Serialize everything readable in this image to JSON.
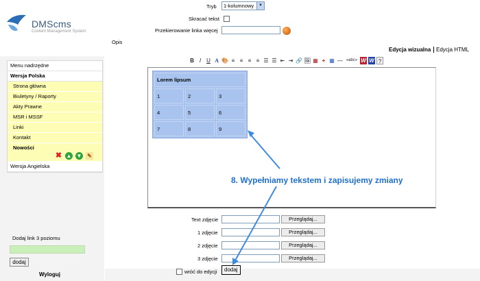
{
  "brand": {
    "name": "DMScms",
    "tagline": "Content Management System"
  },
  "sidebar": {
    "menu_items": [
      {
        "label": "Menu nadrzędne",
        "style": "plain"
      },
      {
        "label": "Wersja Polska",
        "style": "bold"
      },
      {
        "label": "Strona główna",
        "style": "sub"
      },
      {
        "label": "Biuletyny / Raporty",
        "style": "sub"
      },
      {
        "label": "Akty Prawne",
        "style": "sub"
      },
      {
        "label": "MSR i MSSF",
        "style": "sub"
      },
      {
        "label": "Linki",
        "style": "sub"
      },
      {
        "label": "Kontakt",
        "style": "sub"
      },
      {
        "label": "Nowości",
        "style": "sub-bold"
      },
      {
        "label": "Wersja Angielska",
        "style": "plain"
      }
    ],
    "row_actions": [
      "delete-icon",
      "move-up-icon",
      "move-down-icon",
      "edit-icon"
    ],
    "add_link_label": "Dodaj link 3 poziomu",
    "add_link_value": "",
    "add_button": "dodaj",
    "logout": "Wyloguj"
  },
  "form": {
    "tryb_label": "Tryb",
    "tryb_value": "1-kolumnowy",
    "skracac_label": "Skracać tekst",
    "skracac_checked": false,
    "redirect_label": "Przekierowanie linka więcej",
    "redirect_value": "",
    "opis_label": "Opis",
    "tab_visual": "Edycja wizualna",
    "tab_html": "Edycja HTML",
    "toolbar": [
      "B",
      "I",
      "U",
      "A",
      "🎨",
      "≡",
      "≡",
      "≡",
      "≡",
      "☰",
      "☰",
      "⇤",
      "⇥",
      "🔗",
      "🖼",
      "▦",
      "+",
      "▦",
      "—",
      "»abc»",
      "W",
      "W",
      "?"
    ],
    "editor_table": {
      "header": "Lorem lipsum",
      "rows": [
        [
          "1",
          "2",
          "3"
        ],
        [
          "4",
          "5",
          "6"
        ],
        [
          "7",
          "8",
          "9"
        ]
      ]
    },
    "annotation": "8. Wypełniamy tekstem i zapisujemy zmiany",
    "photo_fields": [
      {
        "label": "Text zdjęcie",
        "browse": "Przeglądaj..."
      },
      {
        "label": "1 zdjęcie",
        "browse": "Przeglądaj..."
      },
      {
        "label": "2 zdjęcie",
        "browse": "Przeglądaj..."
      },
      {
        "label": "3 zdjęcie",
        "browse": "Przeglądaj..."
      }
    ],
    "return_label": "wróć do edycji",
    "return_checked": false,
    "save_button": "dodaj"
  },
  "colors": {
    "menu_highlight": "#fdfdb6",
    "table_cell": "#a8c4ee",
    "annotation": "#1e6fd0"
  }
}
